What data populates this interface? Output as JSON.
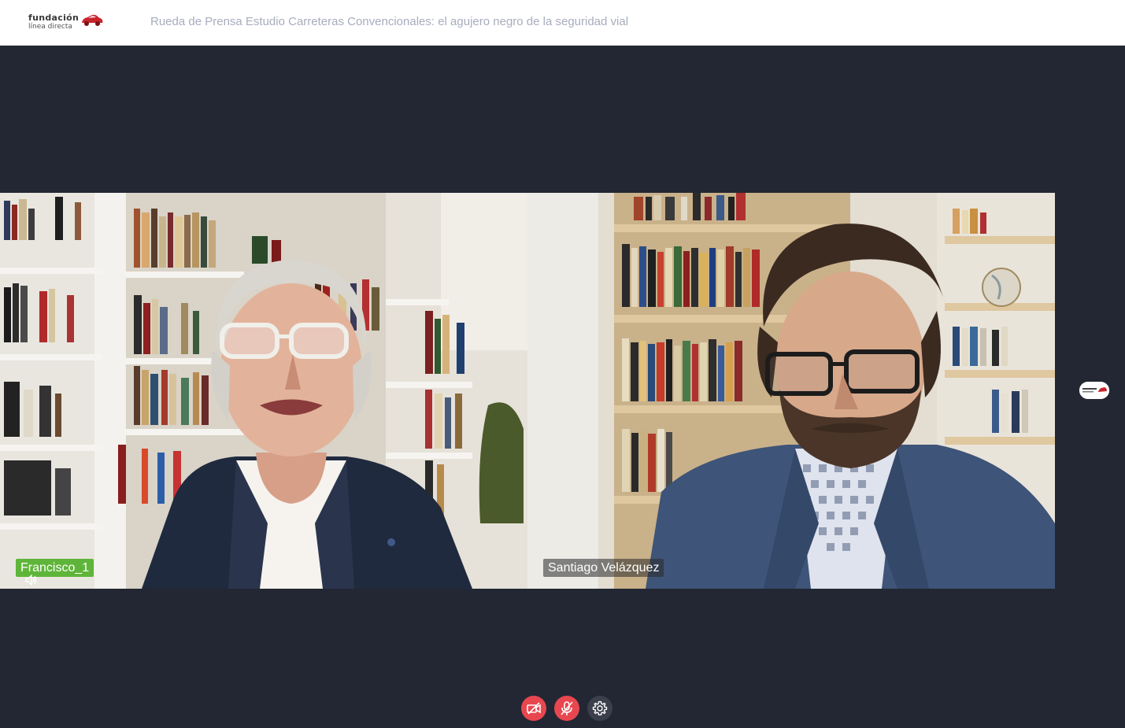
{
  "header": {
    "logo_line1": "fundación",
    "logo_line2": "línea directa",
    "title": "Rueda de Prensa Estudio Carreteras Convencionales: el agujero negro de la seguridad vial"
  },
  "participants": [
    {
      "name": "Francisco_1",
      "speaking": true,
      "icon": "speaker-icon"
    },
    {
      "name": "Santiago Velázquez",
      "speaking": false
    }
  ],
  "side_panel": {
    "thumb_logo": "fundación línea directa"
  },
  "controls": [
    {
      "name": "camera-off-button",
      "icon": "video-off-icon",
      "state": "off"
    },
    {
      "name": "mic-off-button",
      "icon": "mic-off-icon",
      "state": "off"
    },
    {
      "name": "settings-button",
      "icon": "gear-icon"
    }
  ],
  "colors": {
    "background": "#232733",
    "header": "#ffffff",
    "speaking_tag": "#5fb53a",
    "control_off": "#e8474f",
    "control_neutral": "#3b3f4b",
    "title_text": "#a7adbd"
  }
}
